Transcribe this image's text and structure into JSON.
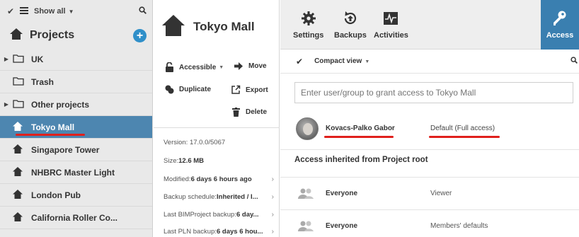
{
  "left": {
    "filter_label": "Show all",
    "header": "Projects",
    "tree": [
      {
        "label": "UK",
        "type": "folder",
        "expandable": true
      },
      {
        "label": "Trash",
        "type": "folder",
        "expandable": false
      },
      {
        "label": "Other projects",
        "type": "folder",
        "expandable": true
      },
      {
        "label": "Tokyo Mall",
        "type": "project",
        "selected": true
      },
      {
        "label": "Singapore Tower",
        "type": "project"
      },
      {
        "label": "NHBRC Master Light",
        "type": "project"
      },
      {
        "label": "London Pub",
        "type": "project"
      },
      {
        "label": "California Roller Co...",
        "type": "project"
      }
    ],
    "selected_color": "#4d86b0"
  },
  "mid": {
    "title": "Tokyo Mall",
    "actions": {
      "accessible": "Accessible",
      "move": "Move",
      "duplicate": "Duplicate",
      "export": "Export",
      "delete": "Delete"
    },
    "info": {
      "version": "Version: 17.0.0/5067",
      "size_label": "Size: ",
      "size_value": "12.6 MB",
      "modified_label": "Modified: ",
      "modified_value": "6 days 6 hours ago",
      "backup_label": "Backup schedule: ",
      "backup_value": "Inherited / I...",
      "bim_label": "Last BIMProject backup: ",
      "bim_value": "6 day...",
      "pln_label": "Last PLN backup: ",
      "pln_value": "6 days 6 hou..."
    }
  },
  "right": {
    "tabs": {
      "settings": "Settings",
      "backups": "Backups",
      "activities": "Activities",
      "access": "Access"
    },
    "view_label": "Compact view",
    "grant_placeholder": "Enter user/group to grant access to Tokyo Mall",
    "user": {
      "name": "Kovacs-Palko Gabor",
      "role": "Default  (Full access)"
    },
    "inherited_title": "Access inherited from Project root",
    "groups": [
      {
        "name": "Everyone",
        "role": "Viewer"
      },
      {
        "name": "Everyone",
        "role": "Members' defaults"
      }
    ],
    "accent_color": "#3a7fb0",
    "highlight_color": "#e0201c"
  }
}
